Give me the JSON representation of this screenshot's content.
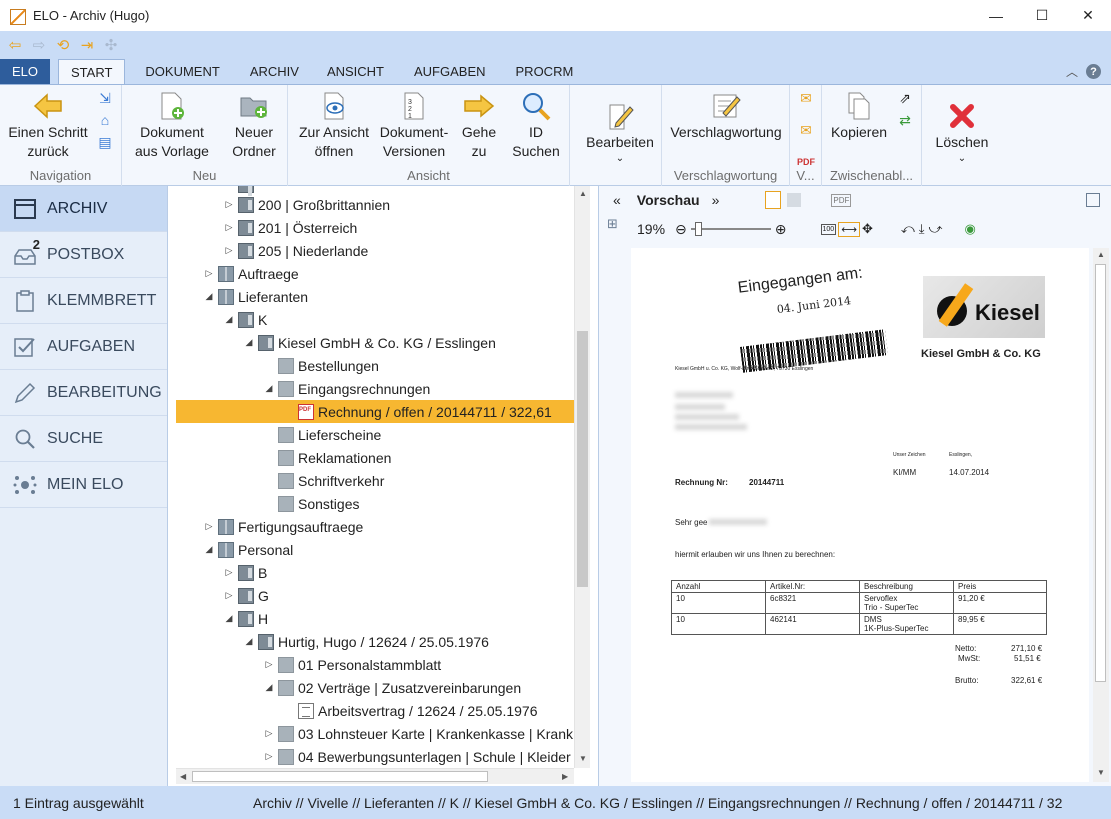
{
  "window": {
    "title": "ELO - Archiv (Hugo)",
    "minimize": "—",
    "maximize": "☐",
    "close": "✕"
  },
  "tabs": [
    {
      "label": "ELO"
    },
    {
      "label": "START"
    },
    {
      "label": "DOKUMENT"
    },
    {
      "label": "ARCHIV"
    },
    {
      "label": "ANSICHT"
    },
    {
      "label": "AUFGABEN"
    },
    {
      "label": "PROCRM"
    }
  ],
  "ribbon": {
    "navigation": {
      "label": "Navigation",
      "back_l1": "Einen Schritt",
      "back_l2": "zurück"
    },
    "neu": {
      "label": "Neu",
      "doc_l1": "Dokument",
      "doc_l2": "aus Vorlage",
      "folder_l1": "Neuer",
      "folder_l2": "Ordner"
    },
    "ansicht": {
      "label": "Ansicht",
      "view_l1": "Zur Ansicht",
      "view_l2": "öffnen",
      "ver_l1": "Dokument-",
      "ver_l2": "Versionen",
      "goto_l1": "Gehe",
      "goto_l2": "zu",
      "id_l1": "ID",
      "id_l2": "Suchen"
    },
    "bearbeiten": {
      "label": "Bearbeiten"
    },
    "verschlag": {
      "button": "Verschlagwortung",
      "label": "Verschlagwortung"
    },
    "v": {
      "label": "V..."
    },
    "zwischen": {
      "button": "Kopieren",
      "label": "Zwischenabl..."
    },
    "loeschen": {
      "label": "Löschen"
    }
  },
  "sidebar": [
    {
      "label": "ARCHIV"
    },
    {
      "label": "POSTBOX",
      "badge": "2"
    },
    {
      "label": "KLEMMBRETT"
    },
    {
      "label": "AUFGABEN"
    },
    {
      "label": "BEARBEITUNG"
    },
    {
      "label": "SUCHE"
    },
    {
      "label": "MEIN ELO"
    }
  ],
  "tree": [
    {
      "label": "200 | Großbrittannien"
    },
    {
      "label": "201 | Österreich"
    },
    {
      "label": "205 | Niederlande"
    },
    {
      "label": "Auftraege"
    },
    {
      "label": "Lieferanten"
    },
    {
      "label": "K"
    },
    {
      "label": "Kiesel GmbH & Co. KG / Esslingen"
    },
    {
      "label": "Bestellungen"
    },
    {
      "label": "Eingangsrechnungen"
    },
    {
      "label": "Rechnung / offen / 20144711 / 322,61"
    },
    {
      "label": "Lieferscheine"
    },
    {
      "label": "Reklamationen"
    },
    {
      "label": "Schriftverkehr"
    },
    {
      "label": "Sonstiges"
    },
    {
      "label": "Fertigungsauftraege"
    },
    {
      "label": "Personal"
    },
    {
      "label": "B"
    },
    {
      "label": "G"
    },
    {
      "label": "H"
    },
    {
      "label": "Hurtig, Hugo / 12624 / 25.05.1976"
    },
    {
      "label": "01 Personalstammblatt"
    },
    {
      "label": "02 Verträge | Zusatzvereinbarungen"
    },
    {
      "label": "Arbeitsvertrag / 12624 / 25.05.1976"
    },
    {
      "label": "03 Lohnsteuer Karte | Krankenkasse | Krank"
    },
    {
      "label": "04 Bewerbungsunterlagen | Schule | Kleider"
    }
  ],
  "preview": {
    "title": "Vorschau",
    "zoom": "19%",
    "doc": {
      "stamp_title": "Eingegangen am:",
      "stamp_date": "04. Juni 2014",
      "company": "Kiesel GmbH & Co. KG",
      "logo": "Kiesel",
      "sender_line": "Kiesel GmbH u. Co. KG, Wolf-Hirth-Straße 2, 73730 Esslingen",
      "unser_zeichen_label": "Unser Zeichen",
      "unser_zeichen": "KI/MM",
      "ort_label": "Esslingen,",
      "datum": "14.07.2014",
      "rechnung_label": "Rechnung Nr:",
      "rechnung_nr": "20144711",
      "anrede": "Sehr gee",
      "text": "hiermit erlauben wir uns Ihnen zu berechnen:",
      "table_headers": [
        "Anzahl",
        "Artikel.Nr:",
        "Beschreibung",
        "Preis"
      ],
      "rows": [
        {
          "anzahl": "10",
          "artikel": "6c8321",
          "beschreibung_1": "Servoflex",
          "beschreibung_2": "Trio - SuperTec",
          "preis": "91,20 €"
        },
        {
          "anzahl": "10",
          "artikel": "462141",
          "beschreibung_1": "DMS",
          "beschreibung_2": "1K-Plus-SuperTec",
          "preis": "89,95 €"
        }
      ],
      "netto_label": "Netto:",
      "netto": "271,10 €",
      "mwst_label": "MwSt:",
      "mwst": "51,51 €",
      "brutto_label": "Brutto:",
      "brutto": "322,61 €"
    }
  },
  "status": {
    "left": "1 Eintrag ausgewählt",
    "path": "Archiv // Vivelle // Lieferanten // K // Kiesel GmbH & Co. KG / Esslingen // Eingangsrechnungen // Rechnung / offen / 20144711 / 32"
  }
}
